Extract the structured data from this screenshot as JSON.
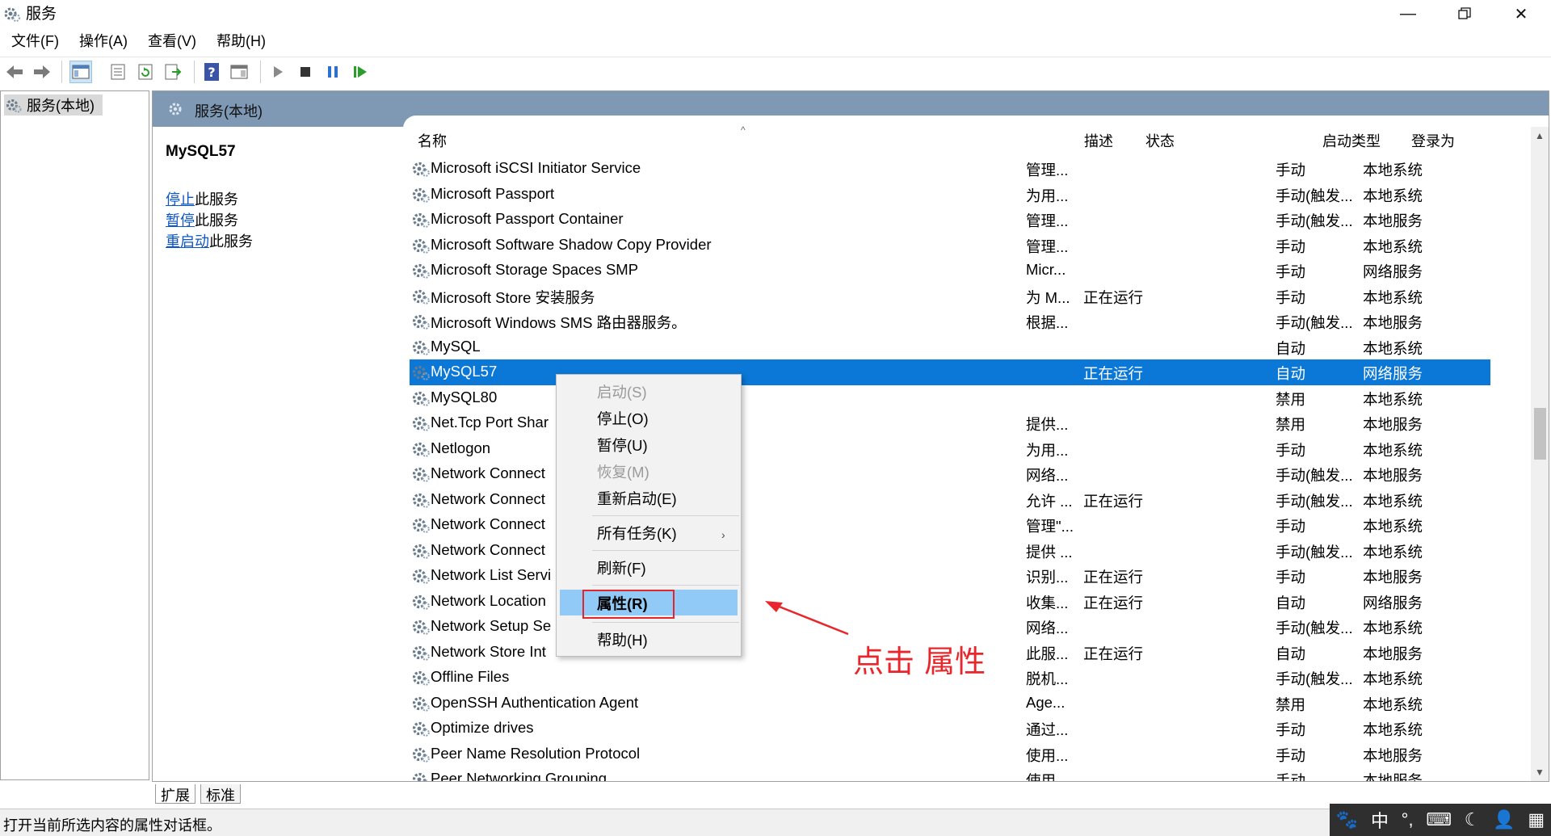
{
  "window": {
    "title": "服务",
    "icon": "services-gear-icon"
  },
  "menubar": {
    "items": [
      "文件(F)",
      "操作(A)",
      "查看(V)",
      "帮助(H)"
    ]
  },
  "toolbar": {
    "icons": [
      "back-arrow-icon",
      "forward-arrow-icon",
      "show-console-tree-icon",
      "properties-sheet-icon",
      "refresh-icon",
      "export-list-icon",
      "help-icon",
      "show-action-pane-icon",
      "play-icon",
      "stop-icon",
      "pause-icon",
      "resume-icon"
    ]
  },
  "tree": {
    "root_label": "服务(本地)"
  },
  "pane": {
    "header_title": "服务(本地)",
    "selected_service": "MySQL57",
    "actions": [
      {
        "link": "停止",
        "rest": "此服务"
      },
      {
        "link": "暂停",
        "rest": "此服务"
      },
      {
        "link": "重启动",
        "rest": "此服务"
      }
    ]
  },
  "table": {
    "columns": {
      "name": "名称",
      "desc": "描述",
      "status": "状态",
      "start": "启动类型",
      "logon": "登录为"
    },
    "rows": [
      {
        "name": "Microsoft iSCSI Initiator Service",
        "desc": "管理...",
        "status": "",
        "start": "手动",
        "logon": "本地系统"
      },
      {
        "name": "Microsoft Passport",
        "desc": "为用...",
        "status": "",
        "start": "手动(触发...",
        "logon": "本地系统"
      },
      {
        "name": "Microsoft Passport Container",
        "desc": "管理...",
        "status": "",
        "start": "手动(触发...",
        "logon": "本地服务"
      },
      {
        "name": "Microsoft Software Shadow Copy Provider",
        "desc": "管理...",
        "status": "",
        "start": "手动",
        "logon": "本地系统"
      },
      {
        "name": "Microsoft Storage Spaces SMP",
        "desc": "Micr...",
        "status": "",
        "start": "手动",
        "logon": "网络服务"
      },
      {
        "name": "Microsoft Store 安装服务",
        "desc": "为 M...",
        "status": "正在运行",
        "start": "手动",
        "logon": "本地系统"
      },
      {
        "name": "Microsoft Windows SMS 路由器服务。",
        "desc": "根据...",
        "status": "",
        "start": "手动(触发...",
        "logon": "本地服务"
      },
      {
        "name": "MySQL",
        "desc": "",
        "status": "",
        "start": "自动",
        "logon": "本地系统"
      },
      {
        "name": "MySQL57",
        "desc": "",
        "status": "正在运行",
        "start": "自动",
        "logon": "网络服务",
        "selected": true
      },
      {
        "name": "MySQL80",
        "desc": "",
        "status": "",
        "start": "禁用",
        "logon": "本地系统"
      },
      {
        "name": "Net.Tcp Port Shar",
        "desc": "提供...",
        "status": "",
        "start": "禁用",
        "logon": "本地服务"
      },
      {
        "name": "Netlogon",
        "desc": "为用...",
        "status": "",
        "start": "手动",
        "logon": "本地系统"
      },
      {
        "name": "Network Connect",
        "desc": "网络...",
        "status": "",
        "start": "手动(触发...",
        "logon": "本地服务"
      },
      {
        "name": "Network Connect",
        "desc": "允许 ...",
        "status": "正在运行",
        "start": "手动(触发...",
        "logon": "本地系统"
      },
      {
        "name": "Network Connect",
        "desc": "管理\"...",
        "status": "",
        "start": "手动",
        "logon": "本地系统"
      },
      {
        "name": "Network Connect",
        "desc": "提供 ...",
        "status": "",
        "start": "手动(触发...",
        "logon": "本地系统"
      },
      {
        "name": "Network List Servi",
        "desc": "识别...",
        "status": "正在运行",
        "start": "手动",
        "logon": "本地服务"
      },
      {
        "name": "Network Location",
        "desc": "收集...",
        "status": "正在运行",
        "start": "自动",
        "logon": "网络服务"
      },
      {
        "name": "Network Setup Se",
        "desc": "网络...",
        "status": "",
        "start": "手动(触发...",
        "logon": "本地系统"
      },
      {
        "name": "Network Store Int",
        "desc": "此服...",
        "status": "正在运行",
        "start": "自动",
        "logon": "本地服务"
      },
      {
        "name": "Offline Files",
        "desc": "脱机...",
        "status": "",
        "start": "手动(触发...",
        "logon": "本地系统"
      },
      {
        "name": "OpenSSH Authentication Agent",
        "desc": "Age...",
        "status": "",
        "start": "禁用",
        "logon": "本地系统"
      },
      {
        "name": "Optimize drives",
        "desc": "通过...",
        "status": "",
        "start": "手动",
        "logon": "本地系统"
      },
      {
        "name": "Peer Name Resolution Protocol",
        "desc": "使用...",
        "status": "",
        "start": "手动",
        "logon": "本地服务"
      },
      {
        "name": "Peer Networking Grouping",
        "desc": "使用...",
        "status": "",
        "start": "手动",
        "logon": "本地服务"
      }
    ]
  },
  "context_menu": {
    "start": "启动(S)",
    "stop": "停止(O)",
    "pause": "暂停(U)",
    "resume": "恢复(M)",
    "restart": "重新启动(E)",
    "all_tasks": "所有任务(K)",
    "refresh": "刷新(F)",
    "properties": "属性(R)",
    "help": "帮助(H)"
  },
  "annotation": {
    "text": "点击 属性",
    "color": "#e8262b"
  },
  "bottom_tabs": [
    "扩展",
    "标准"
  ],
  "statusbar": {
    "text": "打开当前所选内容的属性对话框。"
  },
  "ime": {
    "lang": "中"
  },
  "colors": {
    "selection": "#0b78d7",
    "pane_header": "#7f98b4",
    "menu_highlight": "#91c9f7",
    "link": "#0d56c9"
  }
}
